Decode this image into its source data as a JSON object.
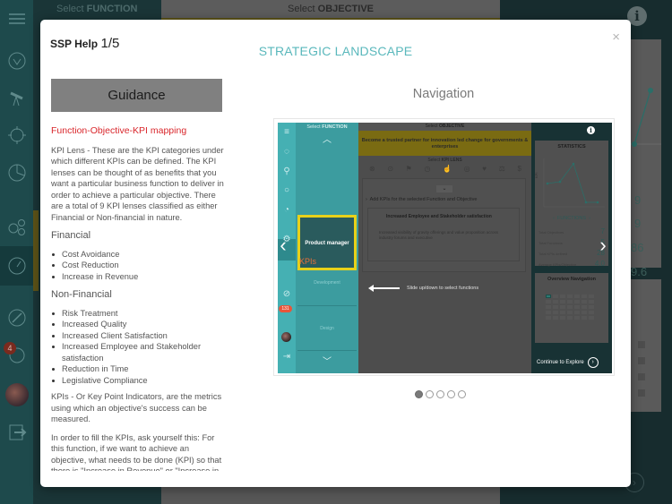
{
  "background": {
    "function_header": {
      "prefix": "Select",
      "bold": "FUNCTION"
    },
    "objective_header": {
      "prefix": "Select",
      "bold": "OBJECTIVE"
    },
    "notification_badge": "4",
    "stat_values": [
      "9",
      "9",
      "86",
      "9.6"
    ],
    "icons": [
      "menu-icon",
      "lightbulb-icon",
      "telescope-icon",
      "target-icon",
      "pie-chart-icon",
      "gears-icon",
      "gauge-icon",
      "compass-icon",
      "refresh-icon",
      "avatar",
      "logout-icon"
    ]
  },
  "modal": {
    "help_label": "SSP Help",
    "help_page": "1/5",
    "title": "STRATEGIC LANDSCAPE",
    "close_glyph": "×",
    "guidance": {
      "button_label": "Guidance",
      "heading": "Function-Objective-KPI mapping",
      "intro": "KPI Lens - These are the KPI categories under which different KPIs can be defined. The KPI lenses can be thought of as benefits that you want a particular business function to deliver in order to achieve a particular objective. There are a total of 9 KPI lenses classified as either Financial or Non-financial in nature.",
      "financial_heading": "Financial",
      "financial_items": [
        "Cost Avoidance",
        "Cost Reduction",
        "Increase in Revenue"
      ],
      "nonfinancial_heading": "Non-Financial",
      "nonfinancial_items": [
        "Risk Treatment",
        "Increased Quality",
        "Increased Client Satisfaction",
        "Increased Employee and Stakeholder satisfaction",
        "Reduction in Time",
        "Legislative Compliance"
      ],
      "kpi_definition": "KPIs - Or Key Point Indicators, are the metrics using which an objective's success can be measured.",
      "kpi_instruction": "In order to fill the KPIs, ask yourself this: For this function, if we want to achieve an objective, what needs to be done (KPI) so that there is \"Increase in Revenue\" or \"Increase in"
    },
    "navigation": {
      "title": "Navigation",
      "carousel": {
        "total_slides": 5,
        "active_slide": 1,
        "prev_glyph": "‹",
        "next_glyph": "›"
      },
      "screenshot": {
        "function_header": {
          "prefix": "Select",
          "bold": "FUNCTION"
        },
        "objective_header": {
          "prefix": "Select",
          "bold": "OBJECTIVE"
        },
        "objective_text": "Become a trusted partner for innovation led change for governments & enterprises",
        "kpi_lens_header": {
          "prefix": "Select",
          "bold": "KPI LENS"
        },
        "selected_function": "Product manager",
        "kpis_label": "KPIs",
        "functions": [
          "Development",
          "Design"
        ],
        "add_kpis": "Add KPIs for the selected Function and Objective",
        "kpi_card_title": "Increased Employee and Stakeholder satisfaction",
        "kpi_card_desc": "Increased visibility of gravity offerings and value proposition across industry forums and executive",
        "slide_hint": "Slide up/down to select functions",
        "badge": "131",
        "statistics_title": "STATISTICS",
        "y_axis": "KPI",
        "functions_label": "FUNCTIONS",
        "stats": [
          {
            "label": "Total Objectives",
            "value": "7"
          },
          {
            "label": "Total Functions",
            "value": "5"
          },
          {
            "label": "Total KPIs defined",
            "value": "28"
          },
          {
            "label": "Average KPIs/Objective",
            "value": "4.0"
          }
        ],
        "overview_title": "Overview Navigation",
        "continue_label": "Continue to Explore"
      }
    }
  }
}
